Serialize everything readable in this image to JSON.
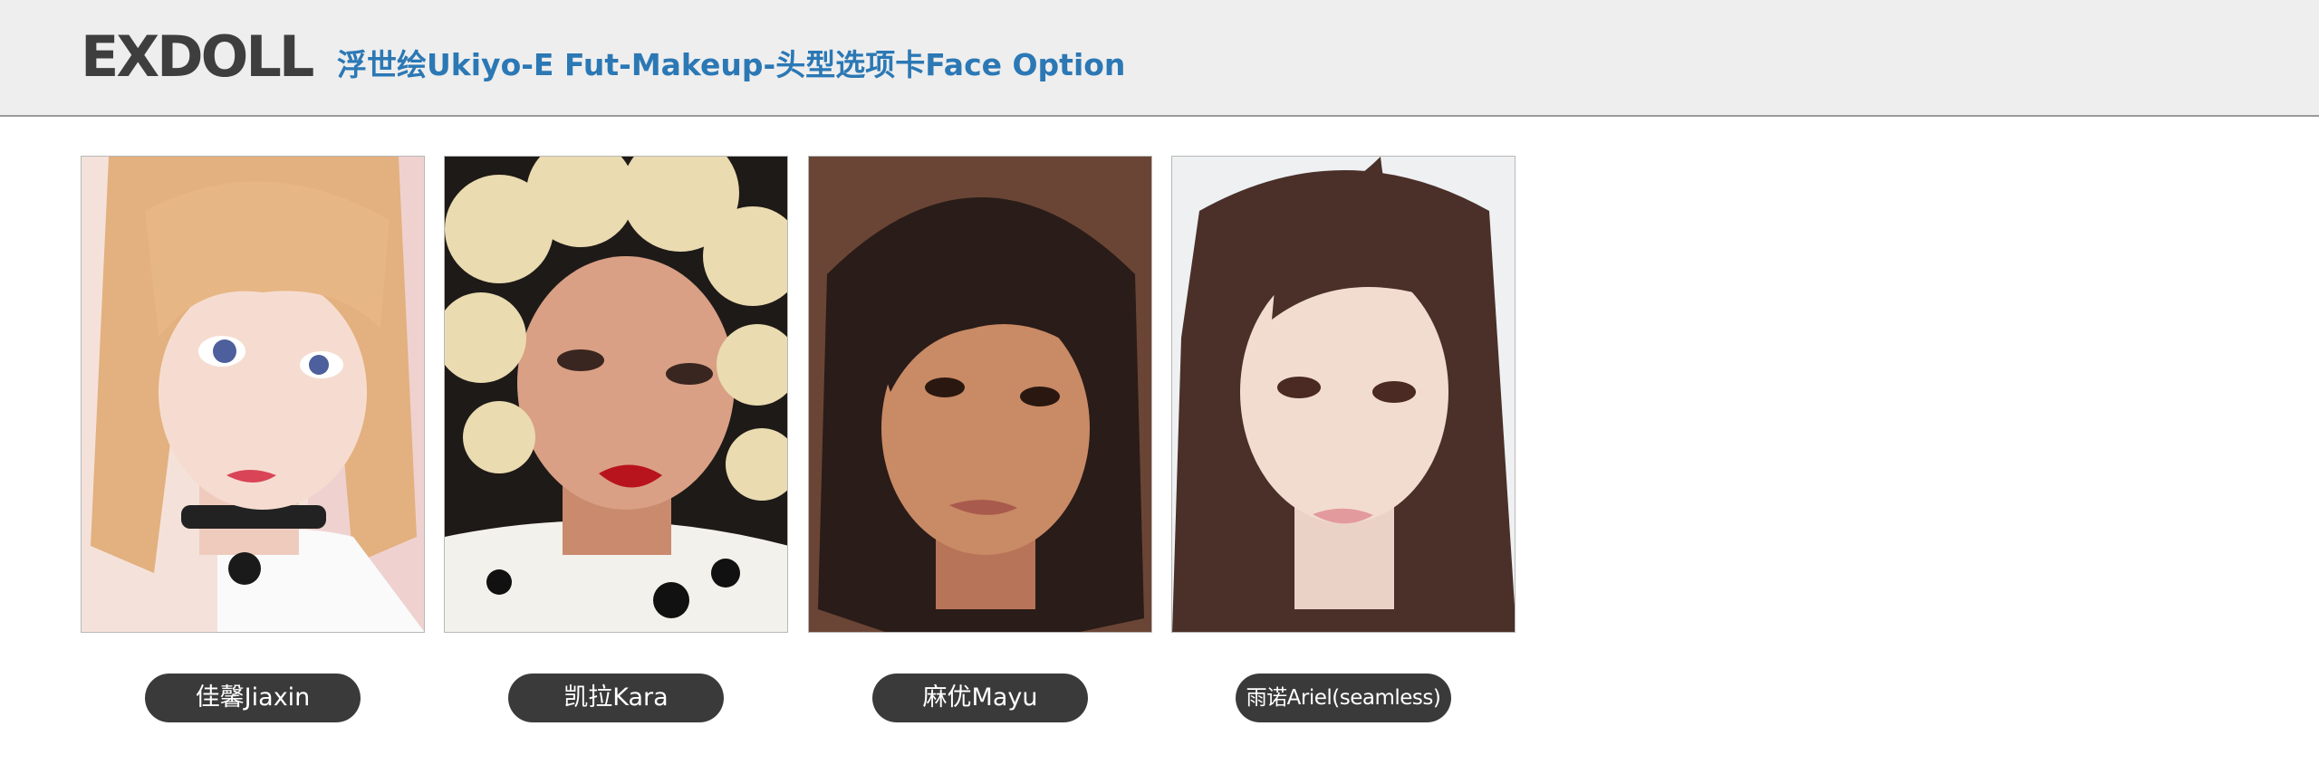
{
  "header": {
    "logo": "EXDOLL",
    "title": "浮世绘Ukiyo-E Fut-Makeup-头型选项卡Face Option"
  },
  "face_options": [
    {
      "name": "佳馨Jiaxin",
      "image": "face-jiaxin-photo",
      "hair_color": "#e8b98e",
      "skin_color": "#f3d9cc"
    },
    {
      "name": "凯拉Kara",
      "image": "face-kara-photo",
      "hair_color": "#e6d3a3",
      "skin_color": "#d99f82"
    },
    {
      "name": "麻优Mayu",
      "image": "face-mayu-photo",
      "hair_color": "#2c1f1a",
      "skin_color": "#c98a66"
    },
    {
      "name": "雨诺Ariel(seamless)",
      "image": "face-ariel-photo",
      "hair_color": "#4a3029",
      "skin_color": "#f2dcd0"
    }
  ]
}
